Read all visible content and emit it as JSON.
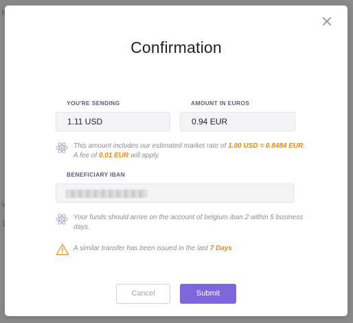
{
  "backdrop": {
    "edge_char_1": "e",
    "edge_char_2": "v",
    "edge_char_3": "1"
  },
  "modal": {
    "title": "Confirmation",
    "close_icon": "close-icon"
  },
  "sending": {
    "label": "YOU'RE SENDING",
    "value": "1.11 USD"
  },
  "euros": {
    "label": "AMOUNT IN EUROS",
    "value": "0.94 EUR"
  },
  "rate_info": {
    "icon": "atom-icon",
    "text_1": "This amount includes our estimated market rate of ",
    "rate": "1.00 USD = 0.8484 EUR",
    "text_2": ". A fee of ",
    "fee": "0.01 EUR",
    "text_3": " will apply."
  },
  "iban": {
    "label": "BENEFICIARY IBAN",
    "value": ""
  },
  "arrival_info": {
    "icon": "atom-icon",
    "text": "Your funds should arrive on the account of belgium iban 2 within 5 business days."
  },
  "warning": {
    "icon": "warning-icon",
    "text": "A similar transfer has been issued in the last ",
    "period": "7 Days"
  },
  "buttons": {
    "cancel": "Cancel",
    "submit": "Submit"
  },
  "colors": {
    "accent": "#e08a1a",
    "primary": "#7d66dc",
    "label": "#5b5e77"
  }
}
